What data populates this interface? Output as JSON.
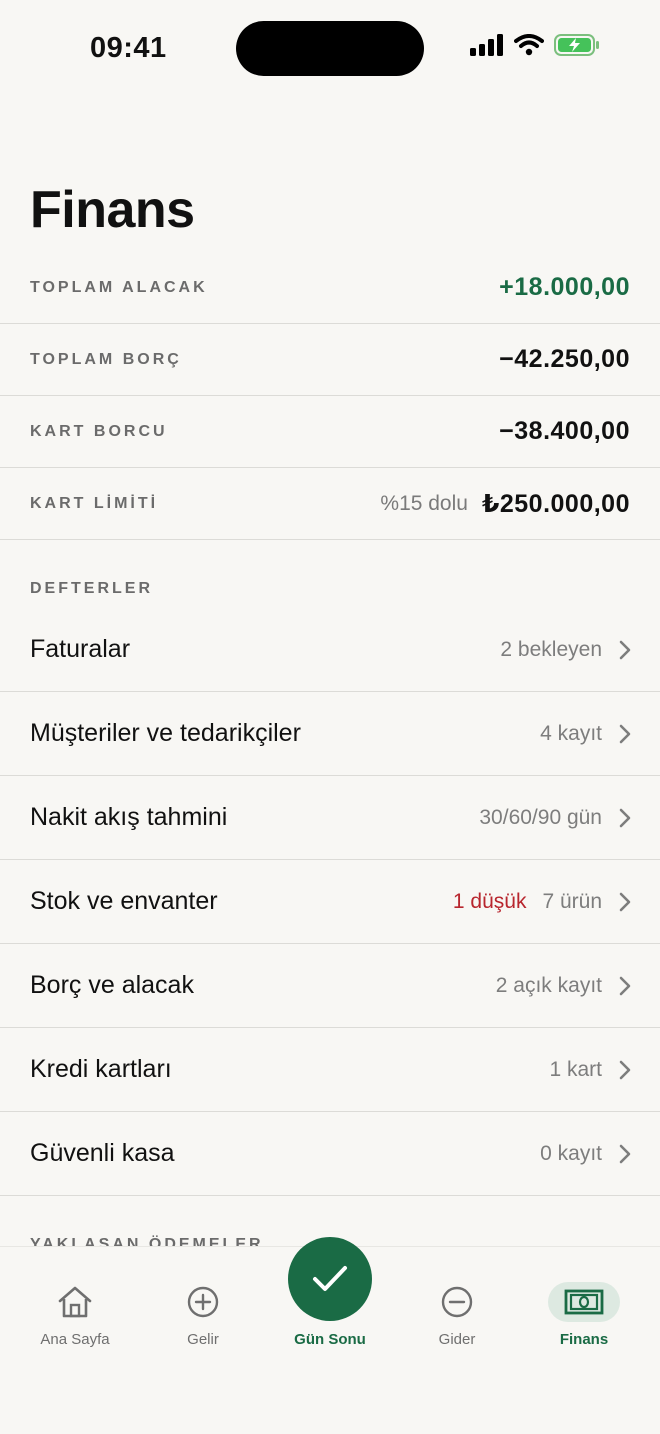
{
  "status_bar": {
    "time": "09:41"
  },
  "page": {
    "title": "Finans"
  },
  "summary": [
    {
      "label": "TOPLAM ALACAK",
      "value": "+18.000,00",
      "note": ""
    },
    {
      "label": "TOPLAM BORÇ",
      "value": "−42.250,00",
      "note": ""
    },
    {
      "label": "KART BORCU",
      "value": "−38.400,00",
      "note": ""
    },
    {
      "label": "KART LİMİTİ",
      "value": "₺250.000,00",
      "note": "%15 dolu"
    }
  ],
  "ledgers_section": {
    "label": "DEFTERLER"
  },
  "ledgers": [
    {
      "title": "Faturalar",
      "meta": "2 bekleyen",
      "warn": ""
    },
    {
      "title": "Müşteriler ve tedarikçiler",
      "meta": "4 kayıt",
      "warn": ""
    },
    {
      "title": "Nakit akış tahmini",
      "meta": "30/60/90 gün",
      "warn": ""
    },
    {
      "title": "Stok ve envanter",
      "meta": "7 ürün",
      "warn": "1 düşük"
    },
    {
      "title": "Borç ve alacak",
      "meta": "2 açık kayıt",
      "warn": ""
    },
    {
      "title": "Kredi kartları",
      "meta": "1 kart",
      "warn": ""
    },
    {
      "title": "Güvenli kasa",
      "meta": "0 kayıt",
      "warn": ""
    }
  ],
  "upcoming_section": {
    "label": "YAKLAŞAN ÖDEMELER"
  },
  "tab_bar": {
    "home": "Ana Sayfa",
    "income": "Gelir",
    "day_end": "Gün Sonu",
    "expense": "Gider",
    "finance": "Finans"
  },
  "colors": {
    "accent": "#1a6b45",
    "warning": "#b8262e",
    "background": "#f8f7f4"
  },
  "icons": [
    "home-icon",
    "plus-circle-icon",
    "check-icon",
    "minus-circle-icon",
    "banknote-icon",
    "chevron-right-icon"
  ]
}
